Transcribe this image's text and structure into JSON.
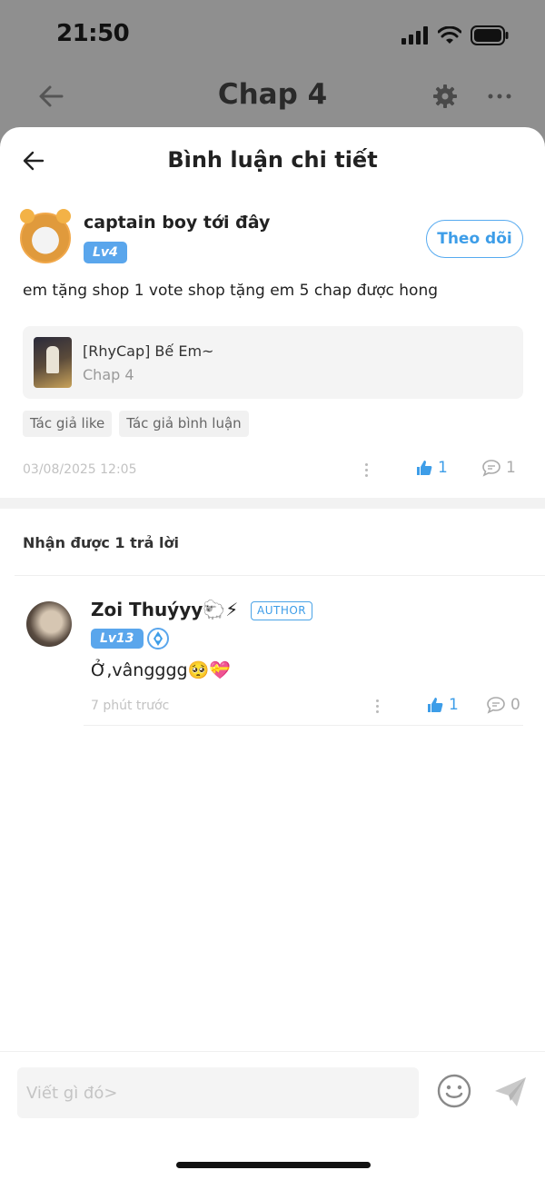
{
  "status_bar": {
    "time": "21:50"
  },
  "nav": {
    "title": "Chap 4"
  },
  "sheet": {
    "title": "Bình luận chi tiết"
  },
  "comment": {
    "username": "captain boy tới đây",
    "level": "Lv4",
    "follow_label": "Theo dõi",
    "text": "em tặng shop 1 vote shop tặng em 5 chap được hong",
    "chapter_card": {
      "name": "[RhyCap] Bế Em~",
      "chapter": "Chap 4"
    },
    "tags": [
      "Tác giả like",
      "Tác giả bình luận"
    ],
    "date": "03/08/2025 12:05",
    "likes": "1",
    "replies": "1"
  },
  "replies_section": {
    "title": "Nhận được 1 trả lời",
    "items": [
      {
        "username": "Zoi Thuýyy🐑⚡",
        "author_badge": "AUTHOR",
        "level": "Lv13",
        "text": "Ở,vângggg🥺💝",
        "time": "7 phút trước",
        "likes": "1",
        "replies": "0"
      }
    ]
  },
  "input": {
    "placeholder": "Viết gì đó>"
  },
  "colors": {
    "accent": "#3d9de8",
    "level_badge": "#5aa6ec",
    "overlay": "#8f8f8f"
  },
  "icons": [
    "back-arrow-icon",
    "gear-icon",
    "more-icon",
    "thumb-up-icon",
    "comment-bubble-icon",
    "kebab-icon",
    "emoji-icon",
    "send-icon",
    "wifi-icon",
    "signal-icon",
    "battery-icon",
    "vip-badge-icon"
  ]
}
